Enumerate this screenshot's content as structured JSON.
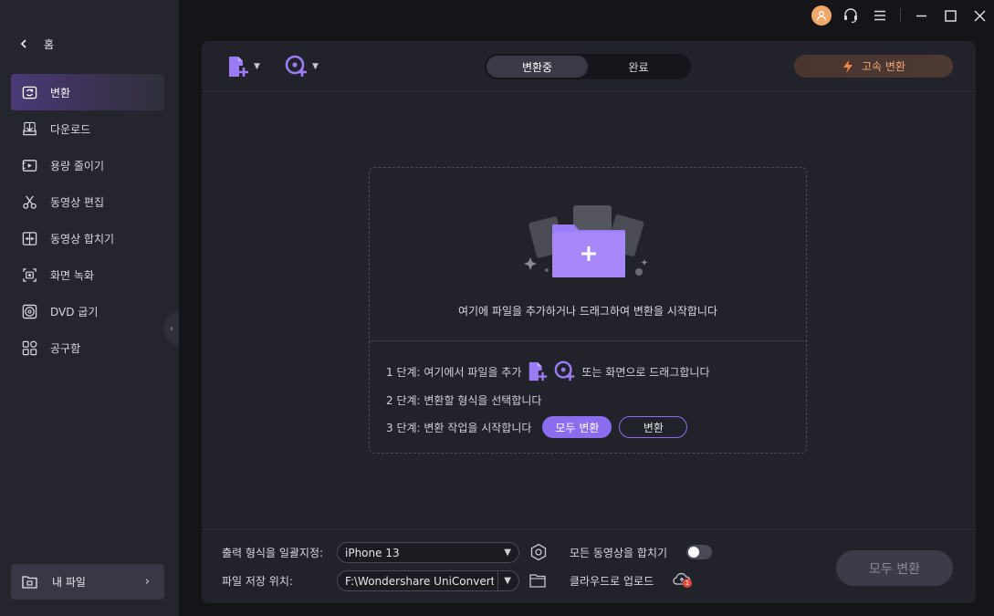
{
  "sidebar": {
    "home_label": "홈",
    "items": [
      {
        "label": "변환",
        "icon": "convert-icon",
        "active": true
      },
      {
        "label": "다운로드",
        "icon": "download-icon"
      },
      {
        "label": "용량 줄이기",
        "icon": "compress-icon"
      },
      {
        "label": "동영상 편집",
        "icon": "scissors-icon"
      },
      {
        "label": "동영상 합치기",
        "icon": "merge-icon"
      },
      {
        "label": "화면 녹화",
        "icon": "record-icon"
      },
      {
        "label": "DVD 굽기",
        "icon": "disc-icon"
      },
      {
        "label": "공구함",
        "icon": "toolbox-icon"
      }
    ],
    "my_files_label": "내 파일"
  },
  "toolbar": {
    "tabs": [
      {
        "label": "변환중",
        "active": true
      },
      {
        "label": "완료",
        "active": false
      }
    ],
    "fast_convert_label": "고속 변환"
  },
  "dropzone": {
    "hint": "여기에 파일을 추가하거나 드래그하여 변환을 시작합니다",
    "step1_prefix": "1 단계: 여기에서 파일을 추가",
    "step1_suffix": "또는 화면으로 드래그합니다",
    "step2": "2 단계: 변환할 형식을 선택합니다",
    "step3": "3 단계: 변환 작업을 시작합니다",
    "convert_all_label": "모두 변환",
    "convert_label": "변환"
  },
  "bottom": {
    "output_format_label": "출력 형식을 일괄지정:",
    "output_format_value": "iPhone 13",
    "save_location_label": "파일 저장 위치:",
    "save_location_value": "F:\\Wondershare UniConverter",
    "merge_label": "모든 동영상을 합치기",
    "cloud_upload_label": "클라우드로 업로드",
    "cloud_badge": "1",
    "convert_all_button": "모두 변환",
    "merge_enabled": false
  },
  "colors": {
    "accent": "#8b6ef0",
    "fast_convert": "#f2a574",
    "avatar": "#f0a868"
  }
}
